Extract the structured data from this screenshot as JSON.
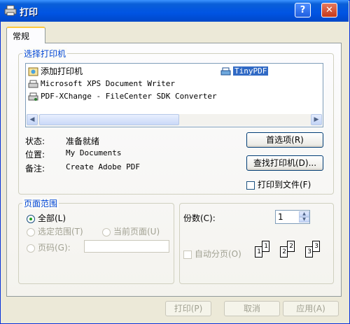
{
  "window": {
    "title": "打印",
    "help_label": "?",
    "close_label": "✕"
  },
  "tab": {
    "label": "常规"
  },
  "printer_group": {
    "legend": "选择打印机",
    "printers": [
      {
        "name": "添加打印机",
        "icon": "add-printer-icon"
      },
      {
        "name": "Microsoft XPS Document Writer",
        "icon": "printer-icon"
      },
      {
        "name": "PDF-XChange - FileCenter SDK Converter",
        "icon": "printer-icon"
      },
      {
        "name": "TinyPDF",
        "icon": "network-printer-icon",
        "selected": true
      }
    ],
    "status_label": "状态:",
    "status_value": "准备就绪",
    "location_label": "位置:",
    "location_value": "My Documents",
    "comment_label": "备注:",
    "comment_value": "Create Adobe PDF",
    "prefs_button": "首选项(R)",
    "find_button": "查找打印机(D)...",
    "print_to_file": "打印到文件(F)"
  },
  "range_group": {
    "legend": "页面范围",
    "all": "全部(L)",
    "selection": "选定范围(T)",
    "current_page": "当前页面(U)",
    "pages": "页码(G):",
    "pages_value": ""
  },
  "copies_group": {
    "copies_label": "份数(C):",
    "copies_value": "1",
    "collate": "自动分页(O)",
    "collate_pages": [
      "1",
      "1",
      "2",
      "2",
      "3",
      "3"
    ]
  },
  "footer": {
    "print": "打印(P)",
    "cancel": "取消",
    "apply": "应用(A)"
  },
  "colors": {
    "accent": "#0054e3",
    "legend": "#0046d5",
    "selection": "#316ac5"
  }
}
